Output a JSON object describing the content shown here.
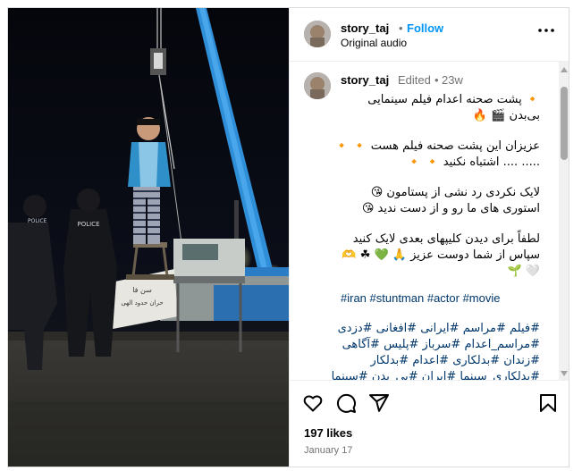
{
  "post": {
    "header": {
      "username": "story_taj",
      "separator": "•",
      "follow_label": "Follow",
      "audio": "Original audio"
    },
    "caption": {
      "username": "story_taj",
      "edited": "Edited",
      "dot": "•",
      "time": "23w",
      "lines": [
        "🔸 پشت صحنه اعدام فیلم سینمایی",
        "بی‌بدن 🎬 🔥",
        "عزیزان این پشت صحنه فیلم هست 🔸 🔸",
        "..... .... اشتباه نکنید 🔸 🔸",
        "لایک نکردی رد نشی از پستامون 😘",
        "استوری های ما رو  و از دست ندید 😘",
        "لطفاً برای دیدن کلیپهای بعدی لایک کنید",
        "سپاس از شما دوست عزیز 🙏 💚 ☘ 🫶",
        "🤍 🌱"
      ],
      "tags_en": "#iran #stuntman #actor #movie",
      "tags_fa": [
        "#فیلم #مراسم #ایرانی #افغانی #دزدی",
        "#مراسم_اعدام #سرباز #پلیس #آگاهی",
        "#زندان #بدلکاری #اعدام #بدلکار",
        "#بدلکاری_سینما #ایران #بی_بدن #سینما"
      ]
    },
    "likes": "197 likes",
    "date": "January 17",
    "icons": {
      "more": "more-options-icon",
      "like": "heart-icon",
      "comment": "comment-icon",
      "share": "share-icon",
      "save": "bookmark-icon"
    },
    "colors": {
      "link": "#00376b",
      "follow": "#0095f6",
      "muted": "#737373"
    }
  },
  "media": {
    "vest_text": "POLICE",
    "banner_text_1": "سن فا",
    "banner_text_2": "حران حدود الهی"
  }
}
